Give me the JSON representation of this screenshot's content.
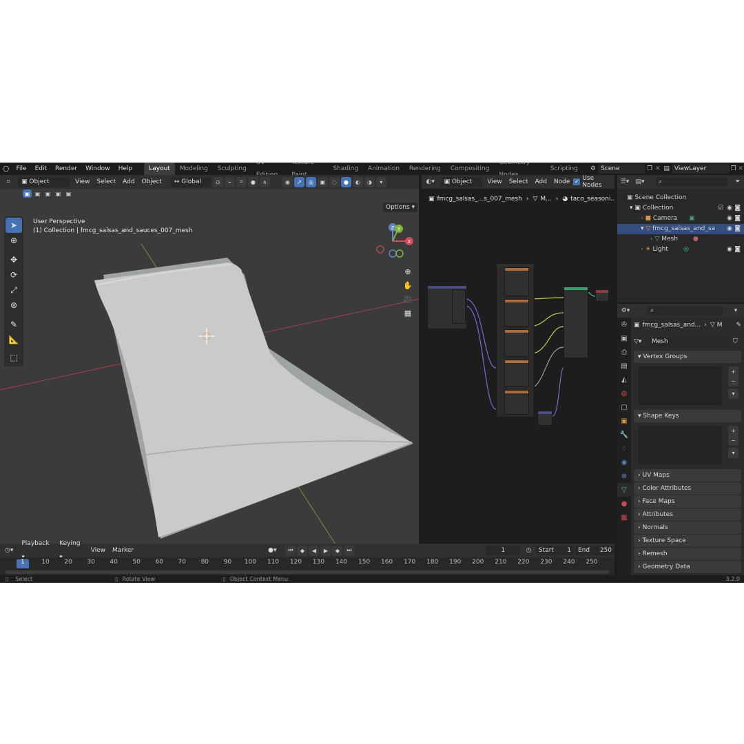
{
  "topbar": {
    "menus": [
      "File",
      "Edit",
      "Render",
      "Window",
      "Help"
    ],
    "workspaces": [
      "Layout",
      "Modeling",
      "Sculpting",
      "UV Editing",
      "Texture Paint",
      "Shading",
      "Animation",
      "Rendering",
      "Compositing",
      "Geometry Nodes",
      "Scripting"
    ],
    "active_workspace": "Layout",
    "scene": "Scene",
    "view_layer": "ViewLayer"
  },
  "viewport_header": {
    "mode": "Object Mode",
    "menus": [
      "View",
      "Select",
      "Add",
      "Object"
    ],
    "orientation": "Global",
    "options": "Options"
  },
  "viewport": {
    "perspective": "User Perspective",
    "collection_info": "(1) Collection | fmcg_salsas_and_sauces_007_mesh",
    "gizmo_x": "X",
    "gizmo_y": "Y",
    "gizmo_z": "Z"
  },
  "node_header": {
    "object_dropdown": "Object",
    "menus": [
      "View",
      "Select",
      "Add",
      "Node"
    ],
    "use_nodes": "Use Nodes",
    "breadcrumb_object": "fmcg_salsas_...s_007_mesh",
    "breadcrumb_mesh": "M...",
    "breadcrumb_material": "taco_seasoni..."
  },
  "outliner": {
    "root": "Scene Collection",
    "items": [
      {
        "label": "Collection"
      },
      {
        "label": "Camera"
      },
      {
        "label": "fmcg_salsas_and_sa"
      },
      {
        "label": "Mesh"
      },
      {
        "label": "Light"
      }
    ]
  },
  "properties": {
    "object_name": "fmcg_salsas_and...",
    "object_short": "M",
    "mesh_name": "Mesh",
    "panels": [
      "Vertex Groups",
      "Shape Keys",
      "UV Maps",
      "Color Attributes",
      "Face Maps",
      "Attributes",
      "Normals",
      "Texture Space",
      "Remesh",
      "Geometry Data"
    ]
  },
  "timeline": {
    "menus": [
      "Playback",
      "Keying",
      "View",
      "Marker"
    ],
    "current_frame": "1",
    "start_label": "Start",
    "start_value": "1",
    "end_label": "End",
    "end_value": "250",
    "ticks": [
      "1",
      "10",
      "20",
      "30",
      "40",
      "50",
      "60",
      "70",
      "80",
      "90",
      "100",
      "110",
      "120",
      "130",
      "140",
      "150",
      "160",
      "170",
      "180",
      "190",
      "200",
      "210",
      "220",
      "230",
      "240",
      "250"
    ]
  },
  "statusbar": {
    "select": "Select",
    "rotate": "Rotate View",
    "context": "Object Context Menu",
    "version": "3.2.0"
  },
  "colors": {
    "accent": "#4772b3",
    "viewport_bg": "#3b3b3b",
    "mesh": "#c9cbcb",
    "x_axis": "#b8434c",
    "y_axis": "#7fa040"
  }
}
